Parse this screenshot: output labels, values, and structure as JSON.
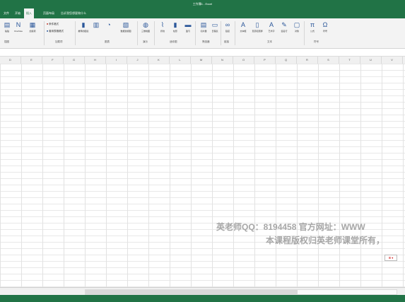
{
  "window": {
    "title": "工作簿1 - Excel"
  },
  "menu": {
    "tabs": [
      "文件",
      "开始",
      "插入",
      "页面布局"
    ],
    "active_index": 1,
    "tell_me": "告诉我您想要做什么"
  },
  "ribbon": {
    "buttons": [
      {
        "label": "粘贴",
        "icon": "paste-icon"
      },
      {
        "label": "OneNote",
        "icon": "onenote-icon"
      },
      {
        "label": "加载项",
        "icon": "addins-icon"
      },
      {
        "label": "条件格式",
        "icon": "conditional-format-icon"
      },
      {
        "label": "套用表格格式",
        "icon": "table-format-icon"
      },
      {
        "label": "推荐的图表",
        "icon": "recommended-charts-icon"
      },
      {
        "label": "数据透视图",
        "icon": "pivot-chart-icon"
      },
      {
        "label": "三维地图",
        "icon": "3d-map-icon"
      },
      {
        "label": "折线",
        "icon": "sparkline-line-icon"
      },
      {
        "label": "柱形",
        "icon": "sparkline-column-icon"
      },
      {
        "label": "盈亏",
        "icon": "sparkline-winloss-icon"
      },
      {
        "label": "切片器",
        "icon": "slicer-icon"
      },
      {
        "label": "日程表",
        "icon": "timeline-icon"
      },
      {
        "label": "链接",
        "icon": "link-icon"
      },
      {
        "label": "文本框",
        "icon": "textbox-icon"
      },
      {
        "label": "页眉和页脚",
        "icon": "header-footer-icon"
      },
      {
        "label": "艺术字",
        "icon": "wordart-icon"
      },
      {
        "label": "签名行",
        "icon": "signature-icon"
      },
      {
        "label": "对象",
        "icon": "object-icon"
      },
      {
        "label": "公式",
        "icon": "equation-icon"
      },
      {
        "label": "符号",
        "icon": "symbol-icon"
      }
    ],
    "groups": [
      "插图",
      "加载项",
      "图表",
      "演示",
      "迷你图",
      "筛选器",
      "链接",
      "文本",
      "符号"
    ]
  },
  "columns": [
    "D",
    "E",
    "F",
    "G",
    "H",
    "I",
    "J",
    "K",
    "L",
    "M",
    "N",
    "O",
    "P",
    "Q",
    "R",
    "S",
    "T",
    "U",
    "V"
  ],
  "watermark": {
    "line1": "英老师QQ：8194458 官方网址：WWW",
    "line2": "本课程版权归英老师课堂所有，"
  },
  "quick_analysis": "⊞ ▾"
}
